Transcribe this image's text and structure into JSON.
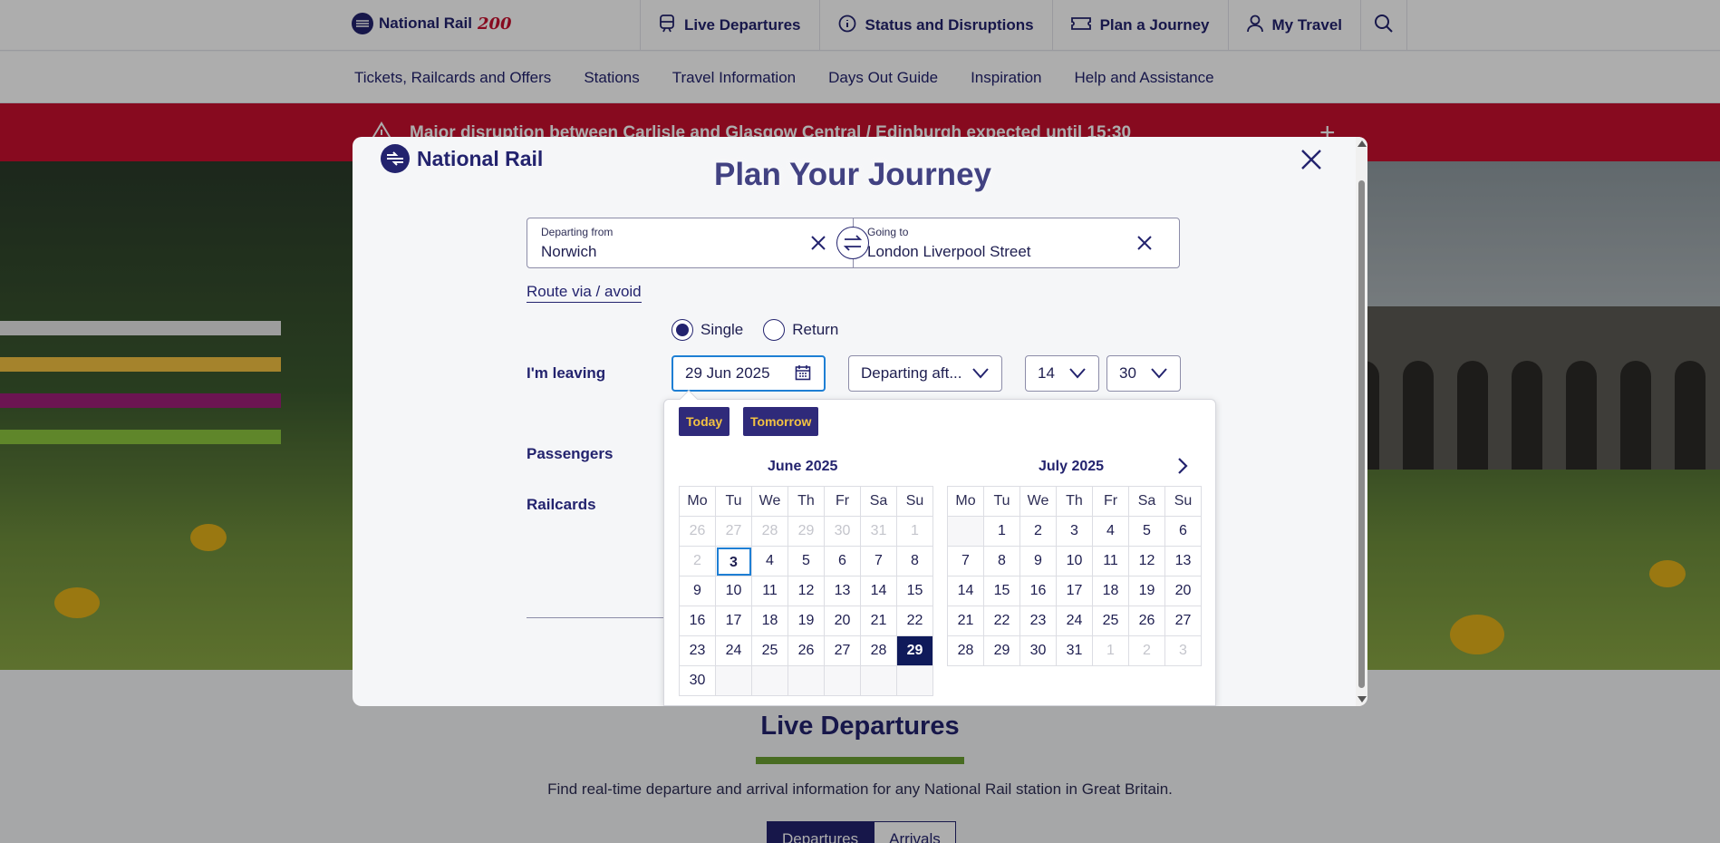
{
  "topbar": {
    "brand": "National Rail",
    "brand_badge": "200",
    "nav": [
      {
        "label": "Live Departures"
      },
      {
        "label": "Status and Disruptions"
      },
      {
        "label": "Plan a Journey"
      },
      {
        "label": "My Travel"
      }
    ]
  },
  "subnav": [
    "Tickets, Railcards and Offers",
    "Stations",
    "Travel Information",
    "Days Out Guide",
    "Inspiration",
    "Help and Assistance"
  ],
  "alert": {
    "text": "Major disruption between Carlisle and Glasgow Central / Edinburgh expected until 15:30"
  },
  "live_departures": {
    "title": "Live Departures",
    "description": "Find real-time departure and arrival information for any National Rail station in Great Britain.",
    "tabs": [
      "Departures",
      "Arrivals"
    ]
  },
  "modal": {
    "brand": "National Rail",
    "title": "Plan Your Journey",
    "from": {
      "label": "Departing from",
      "value": "Norwich"
    },
    "to": {
      "label": "Going to",
      "value": "London Liverpool Street"
    },
    "route_link": "Route via / avoid",
    "journey_type": {
      "single": "Single",
      "return": "Return",
      "selected": "Single"
    },
    "leaving_label": "I'm leaving",
    "passengers_label": "Passengers",
    "railcards_label": "Railcards",
    "date_value": "29 Jun 2025",
    "time_mode": "Departing aft...",
    "hour": "14",
    "minute": "30"
  },
  "datepicker": {
    "today_label": "Today",
    "tomorrow_label": "Tomorrow",
    "weekdays": [
      "Mo",
      "Tu",
      "We",
      "Th",
      "Fr",
      "Sa",
      "Su"
    ],
    "months": [
      {
        "title": "June 2025",
        "weeks": [
          [
            "26",
            "27",
            "28",
            "29",
            "30",
            "31",
            "1"
          ],
          [
            "2",
            "3",
            "4",
            "5",
            "6",
            "7",
            "8"
          ],
          [
            "9",
            "10",
            "11",
            "12",
            "13",
            "14",
            "15"
          ],
          [
            "16",
            "17",
            "18",
            "19",
            "20",
            "21",
            "22"
          ],
          [
            "23",
            "24",
            "25",
            "26",
            "27",
            "28",
            "29"
          ],
          [
            "30",
            "",
            "",
            "",
            "",
            "",
            ""
          ]
        ]
      },
      {
        "title": "July 2025",
        "weeks": [
          [
            "",
            "1",
            "2",
            "3",
            "4",
            "5",
            "6"
          ],
          [
            "7",
            "8",
            "9",
            "10",
            "11",
            "12",
            "13"
          ],
          [
            "14",
            "15",
            "16",
            "17",
            "18",
            "19",
            "20"
          ],
          [
            "21",
            "22",
            "23",
            "24",
            "25",
            "26",
            "27"
          ],
          [
            "28",
            "29",
            "30",
            "31",
            "1",
            "2",
            "3"
          ]
        ]
      }
    ]
  }
}
